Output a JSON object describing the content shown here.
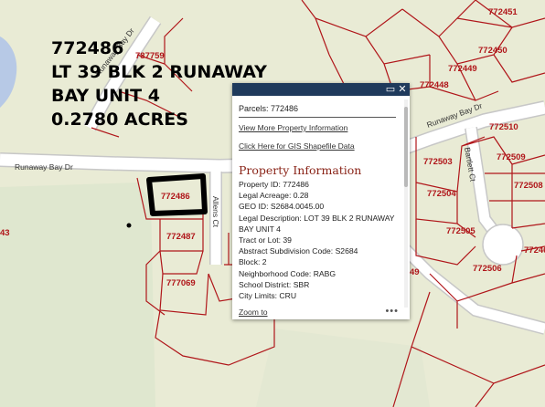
{
  "map": {
    "parcels": [
      "772451",
      "772450",
      "772449",
      "772448",
      "772510",
      "772503",
      "772509",
      "772508",
      "772504",
      "772505",
      "772506",
      "77246",
      "772486",
      "772487",
      "777069",
      "787759",
      "49",
      "43"
    ],
    "roads": [
      "Runaway Bay Dr",
      "Runaway Bay Dr",
      "Runaway Bay Dr",
      "Allens Ct",
      "Bartlett Ct"
    ],
    "colors": {
      "parcel_line": "#b0161a",
      "road_fill": "#ffffff",
      "land": "#e9ebd5",
      "selection": "#000000",
      "popup_header": "#1f3a5c"
    }
  },
  "annotation": {
    "lines": [
      "772486",
      "LT 39 BLK 2 RUNAWAY",
      "BAY UNIT 4",
      "0.2780 ACRES"
    ]
  },
  "popup": {
    "header": {
      "maximize_icon": "maximize-icon",
      "close_icon": "close-icon"
    },
    "title": "Parcels: 772486",
    "links": [
      "View More Property Information",
      "Click Here for GIS Shapefile Data"
    ],
    "heading": "Property Information",
    "fields": [
      {
        "label": "Property ID:",
        "value": "772486"
      },
      {
        "label": "Legal Acreage:",
        "value": "0.28"
      },
      {
        "label": "GEO ID:",
        "value": "S2684.0045.00"
      },
      {
        "label": "Legal Description:",
        "value": "LOT 39 BLK 2 RUNAWAY BAY UNIT 4"
      },
      {
        "label": "Tract or Lot:",
        "value": "39"
      },
      {
        "label": "Abstract Subdivision Code:",
        "value": "S2684"
      },
      {
        "label": "Block:",
        "value": "2"
      },
      {
        "label": "Neighborhood Code:",
        "value": "RABG"
      },
      {
        "label": "School District:",
        "value": "SBR"
      },
      {
        "label": "City Limits:",
        "value": "CRU"
      }
    ],
    "footer": {
      "zoom_label": "Zoom to",
      "more_label": "•••"
    }
  }
}
